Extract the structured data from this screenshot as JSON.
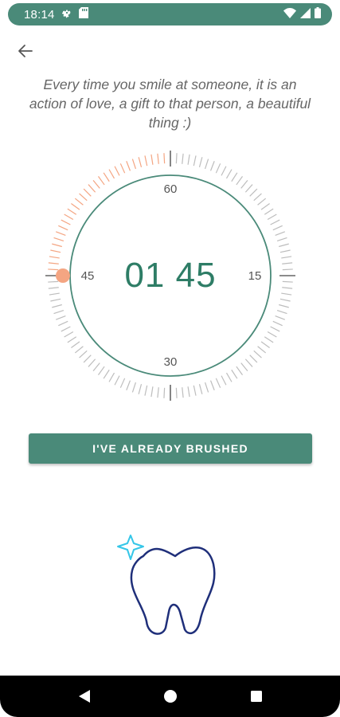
{
  "status_bar": {
    "time": "18:14",
    "icons": [
      "gear-icon",
      "sd-card-icon",
      "wifi-icon",
      "signal-icon",
      "battery-icon"
    ]
  },
  "header": {
    "back_icon": "arrow-left-icon"
  },
  "quote": {
    "text": "Every time you smile at someone, it is an action of love, a gift to that person, a beautiful thing :)"
  },
  "timer": {
    "display": "01 45",
    "dial_labels": {
      "top": "60",
      "right": "15",
      "bottom": "30",
      "left": "45"
    },
    "progress_fraction": 0.75
  },
  "actions": {
    "brushed_label": "I'VE ALREADY BRUSHED"
  },
  "illustration": {
    "icon": "tooth-sparkle-icon"
  },
  "nav_bar": {
    "icons": [
      "back-triangle-icon",
      "home-circle-icon",
      "recents-square-icon"
    ]
  },
  "colors": {
    "primary": "#4a8a79",
    "timer_text": "#2e7d66",
    "progress": "#f4a582",
    "tick": "#bdbdbd",
    "tooth_outline": "#1f2f7a",
    "sparkle": "#34c6e8"
  }
}
